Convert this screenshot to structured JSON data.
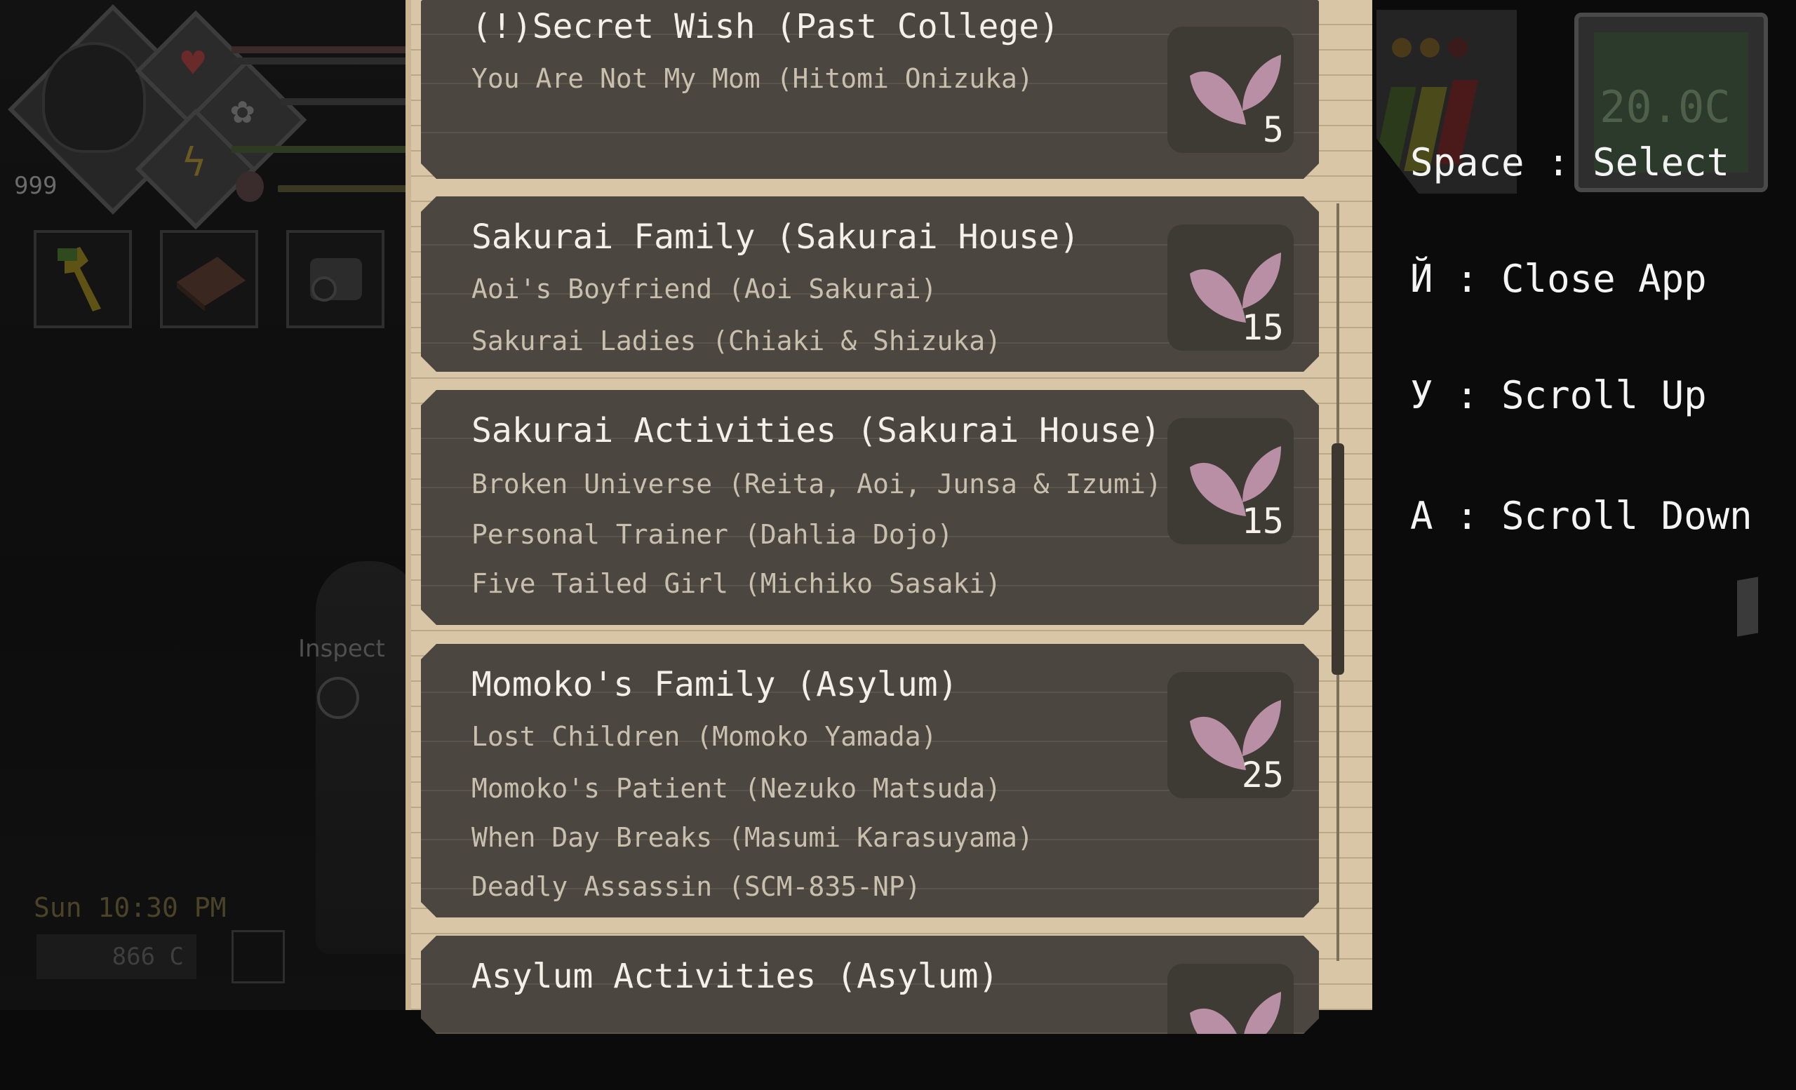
{
  "hud_left": {
    "level": "999",
    "inspect_label": "Inspect",
    "time": "Sun 10:30 PM",
    "money": "866 C"
  },
  "quest_groups": [
    {
      "title": "(!)Secret Wish (Past College)",
      "reward": "5",
      "quests": [
        "You Are Not My Mom (Hitomi Onizuka)"
      ]
    },
    {
      "title": "Sakurai Family (Sakurai House)",
      "reward": "15",
      "quests": [
        "Aoi's Boyfriend (Aoi Sakurai)",
        "Sakurai Ladies (Chiaki & Shizuka)"
      ]
    },
    {
      "title": "Sakurai Activities (Sakurai House)",
      "reward": "15",
      "quests": [
        "Broken Universe (Reita, Aoi, Junsa & Izumi)",
        "Personal Trainer (Dahlia Dojo)",
        "Five Tailed Girl (Michiko Sasaki)"
      ]
    },
    {
      "title": "Momoko's Family (Asylum)",
      "reward": "25",
      "quests": [
        "Lost Children (Momoko Yamada)",
        "Momoko's Patient (Nezuko Matsuda)",
        "When Day Breaks (Masumi Karasuyama)",
        "Deadly Assassin (SCM-835-NP)"
      ]
    },
    {
      "title": "Asylum Activities (Asylum)",
      "reward": "",
      "quests": []
    }
  ],
  "hud_right": {
    "thermo_reading": "20.0C",
    "controls": [
      {
        "label": "Space : Select"
      },
      {
        "label": "Й : Close App"
      },
      {
        "label": "У : Scroll Up"
      },
      {
        "label": "A : Scroll Down"
      }
    ]
  },
  "colors": {
    "panel_bg": "#d8c6a6",
    "card_bg": "#4b463f",
    "title_text": "#f4f0e8",
    "quest_text": "#c9bfae",
    "badge_leaf": "#b98fa6"
  },
  "icons": [
    "heart-icon",
    "paw-icon",
    "bolt-icon",
    "wrench-icon",
    "book-icon",
    "camera-icon",
    "leaf-reward-icon",
    "scroll-tab-icon"
  ]
}
